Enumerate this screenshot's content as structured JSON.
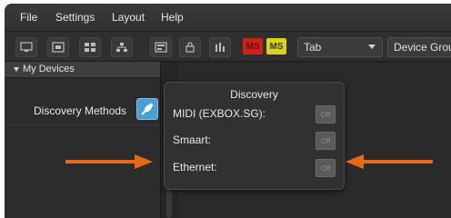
{
  "menu": {
    "items": [
      {
        "label": "File"
      },
      {
        "label": "Settings"
      },
      {
        "label": "Layout"
      },
      {
        "label": "Help"
      }
    ]
  },
  "toolbar": {
    "icons": [
      "monitor-icon",
      "window-icon",
      "grid-icon",
      "network-icon",
      "panel-icon",
      "lock-icon",
      "meter-icon"
    ],
    "badge_red": "MS",
    "badge_yellow": "MS",
    "tab_select_value": "Tab",
    "device_groups_label": "Device Groups"
  },
  "sidebar": {
    "header": "My Devices",
    "discovery_label": "Discovery Methods"
  },
  "popover": {
    "title": "Discovery",
    "rows": [
      {
        "label": "MIDI (EXBOX.SG):",
        "state": "Off"
      },
      {
        "label": "Smaart:",
        "state": "Off"
      },
      {
        "label": "Ethernet:",
        "state": "Off"
      }
    ]
  },
  "colors": {
    "annotation_arrow": "#e46a1a",
    "badge_red": "#d0201a",
    "badge_yellow": "#d8d21e",
    "discovery_icon": "#4a9fd1"
  }
}
